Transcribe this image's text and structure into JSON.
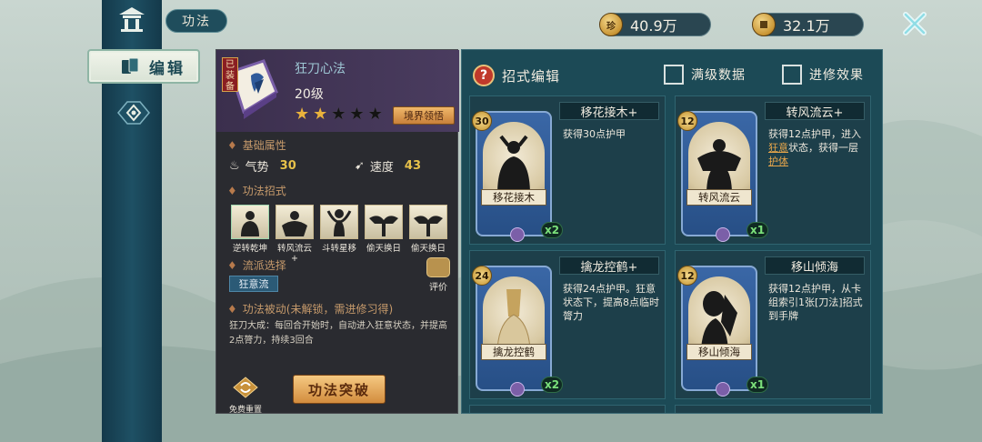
{
  "colors": {
    "accent_gold": "#e9b23c",
    "panel_dark": "#2a2b30",
    "panel_teal": "#1c4a56",
    "bonus_green": "#7be07a",
    "keyword_orange": "#e7a64b"
  },
  "nav": {
    "title": "功法",
    "side_tab_label": "编辑"
  },
  "currency": [
    {
      "icon": "jade-coin-icon",
      "glyph": "珍",
      "value": "40.9万"
    },
    {
      "icon": "copper-coin-icon",
      "glyph": "",
      "value": "32.1万"
    }
  ],
  "skill": {
    "equipped_badge": "已装备",
    "name": "狂刀心法",
    "level": "20级",
    "stars_total": 5,
    "stars_filled": 2,
    "realm_button": "境界领悟",
    "base_attr_title": "基础属性",
    "attrs": [
      {
        "label": "气势",
        "value": "30",
        "icon": "flame-icon"
      },
      {
        "label": "速度",
        "value": "43",
        "icon": "boot-icon"
      }
    ],
    "moves_title": "功法招式",
    "moves": [
      {
        "name": "逆转乾坤",
        "plus": ""
      },
      {
        "name": "转风流云",
        "plus": "+"
      },
      {
        "name": "斗转星移",
        "plus": ""
      },
      {
        "name": "偷天换日",
        "plus": ""
      },
      {
        "name": "偷天换日",
        "plus": ""
      }
    ],
    "faction_title": "流派选择",
    "faction_tag": "狂意流",
    "rate_label": "评价",
    "passive_title": "功法被动(未解锁，需进修习得)",
    "passive_desc": "狂刀大成：每回合开始时，自动进入狂意状态，并提高2点膂力，持续3回合",
    "reset_label": "免费重置",
    "break_button": "功法突破"
  },
  "moves_panel": {
    "title": "招式编辑",
    "help_glyph": "?",
    "checkbox_max": "满级数据",
    "checkbox_advance": "进修效果",
    "cards": [
      {
        "name": "移花接木+",
        "art_label": "移花接木",
        "cost": "30",
        "count": "x2",
        "desc_parts": [
          {
            "t": "获得30点护甲",
            "c": ""
          }
        ]
      },
      {
        "name": "转风流云+",
        "art_label": "转风流云",
        "cost": "12",
        "count": "x1",
        "desc_parts": [
          {
            "t": "获得12点护甲，进入",
            "c": ""
          },
          {
            "t": "狂意",
            "c": "hl-u"
          },
          {
            "t": "状态，获得一层",
            "c": ""
          },
          {
            "t": "护体",
            "c": "hl-u"
          }
        ]
      },
      {
        "name": "擒龙控鹤+",
        "art_label": "擒龙控鹤",
        "cost": "24",
        "count": "x2",
        "desc_parts": [
          {
            "t": "获得24点护甲。狂意状态下，提高8点临时膂力",
            "c": ""
          }
        ]
      },
      {
        "name": "移山倾海",
        "art_label": "移山倾海",
        "cost": "12",
        "count": "x1",
        "desc_parts": [
          {
            "t": "获得12点护甲，从卡组索引1张[刀法]招式到手牌",
            "c": ""
          }
        ]
      }
    ]
  }
}
